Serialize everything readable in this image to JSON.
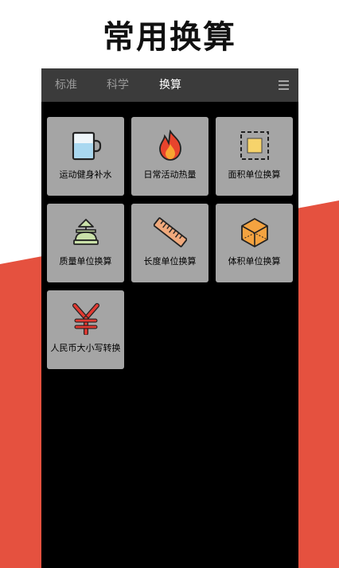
{
  "headline": "常用换算",
  "tabs": [
    {
      "label": "标准",
      "active": false
    },
    {
      "label": "科学",
      "active": false
    },
    {
      "label": "换算",
      "active": true
    }
  ],
  "menu_icon": "hamburger-menu-icon",
  "tools": [
    {
      "label": "运动健身补水",
      "icon": "water-cup-icon"
    },
    {
      "label": "日常活动热量",
      "icon": "flame-icon"
    },
    {
      "label": "面积单位换算",
      "icon": "area-square-icon"
    },
    {
      "label": "质量单位换算",
      "icon": "weight-scale-icon"
    },
    {
      "label": "长度单位换算",
      "icon": "ruler-icon"
    },
    {
      "label": "体积单位换算",
      "icon": "cube-icon"
    },
    {
      "label": "人民币大小写转换",
      "icon": "yuan-icon"
    }
  ],
  "colors": {
    "accent_red": "#e5513f",
    "tab_bar": "#3b3b3b",
    "tile": "#a5a5a5",
    "screen": "#000000"
  }
}
